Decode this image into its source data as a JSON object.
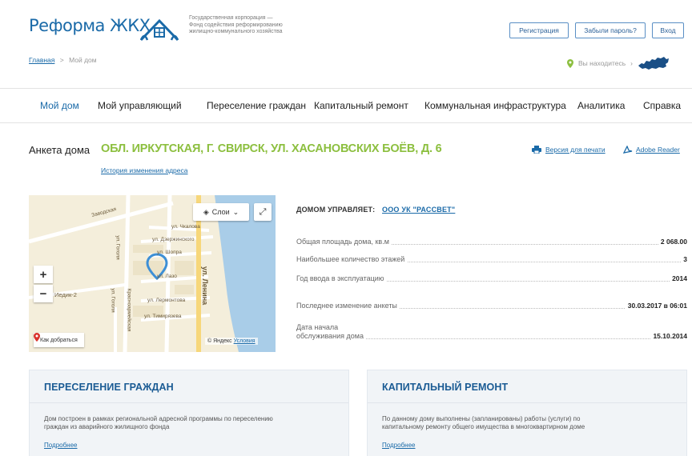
{
  "header": {
    "logo_text": "Реформа ЖКХ",
    "org_lines": [
      "Государственная корпорация —",
      "Фонд содействия реформированию",
      "жилищно-коммунального хозяйства"
    ],
    "register_label": "Регистрация",
    "forgot_label": "Забыли пароль?",
    "login_label": "Вход",
    "location_label": "Вы находитесь"
  },
  "breadcrumb": {
    "home": "Главная",
    "separator": ">",
    "current": "Мой дом"
  },
  "nav": {
    "items": [
      "Мой дом",
      "Мой управляющий",
      "Переселение граждан",
      "Капитальный ремонт",
      "Коммунальная инфраструктура",
      "Аналитика",
      "Справка"
    ],
    "active": "Мой дом"
  },
  "title": {
    "label": "Анкета дома",
    "address": "ОБЛ. ИРКУТСКАЯ, Г. СВИРСК, УЛ. ХАСАНОВСКИХ БОЁВ, Д. 6",
    "history_link": "История изменения адреса",
    "print_link": "Версия для печати",
    "reader_link": "Adobe Reader"
  },
  "map": {
    "layers_label": "Слои",
    "zoom_in": "+",
    "zoom_out": "−",
    "route_label": "Как добраться",
    "copyright": "© Яндекс",
    "terms_link": "Условия",
    "streets": {
      "zavodskaya": "Заводская",
      "chkalova": "ул. Чкалова",
      "dzerzhinskogo": "ул. Дзержинского",
      "shkolnaya": "ул. Шопра",
      "lenina": "ул. Ленина",
      "lazo": "ул. Лазо",
      "gogolya": "ул. Гоголя",
      "lermontova": "ул. Лермонтова",
      "timiryazeva": "ул. Тимирязева",
      "krasnoarm": "Красноармейская",
      "gogolya2": "ул. Гоголя",
      "district": "Иедик-2"
    },
    "colors": {
      "road": "#ffffff",
      "major_road": "#f7d77a",
      "water": "#a9cde8",
      "land": "#f4eedb",
      "pin": "#3d8fd6"
    }
  },
  "info": {
    "managed_label": "ДОМОМ УПРАВЛЯЕТ:",
    "managed_company": "ООО УК \"РАССВЕТ\"",
    "rows": [
      {
        "label": "Общая площадь дома, кв.м",
        "value": "2 068.00"
      },
      {
        "label": "Наибольшее количество этажей",
        "value": "3"
      },
      {
        "label": "Год ввода в эксплуатацию",
        "value": "2014"
      },
      {
        "label": "Последнее изменение анкеты",
        "value": "30.03.2017 в 06:01"
      },
      {
        "label_line1": "Дата начала",
        "label_line2": "обслуживания дома",
        "value": "15.10.2014"
      }
    ]
  },
  "cards": [
    {
      "title": "ПЕРЕСЕЛЕНИЕ ГРАЖДАН",
      "text_lines": [
        "Дом построен в рамках региональной адресной программы по переселению",
        "граждан из аварийного жилищного фонда"
      ],
      "more": "Подробнее"
    },
    {
      "title": "КАПИТАЛЬНЫЙ РЕМОНТ",
      "text_lines": [
        "По данному дому выполнены (запланированы) работы (услуги) по",
        "капитальному ремонту общего имущества в многоквартирном доме"
      ],
      "more": "Подробнее"
    }
  ],
  "colors": {
    "brand_blue": "#1a6aa8",
    "address_green": "#8cbf3f",
    "location_pin": "#8cbf3f"
  }
}
